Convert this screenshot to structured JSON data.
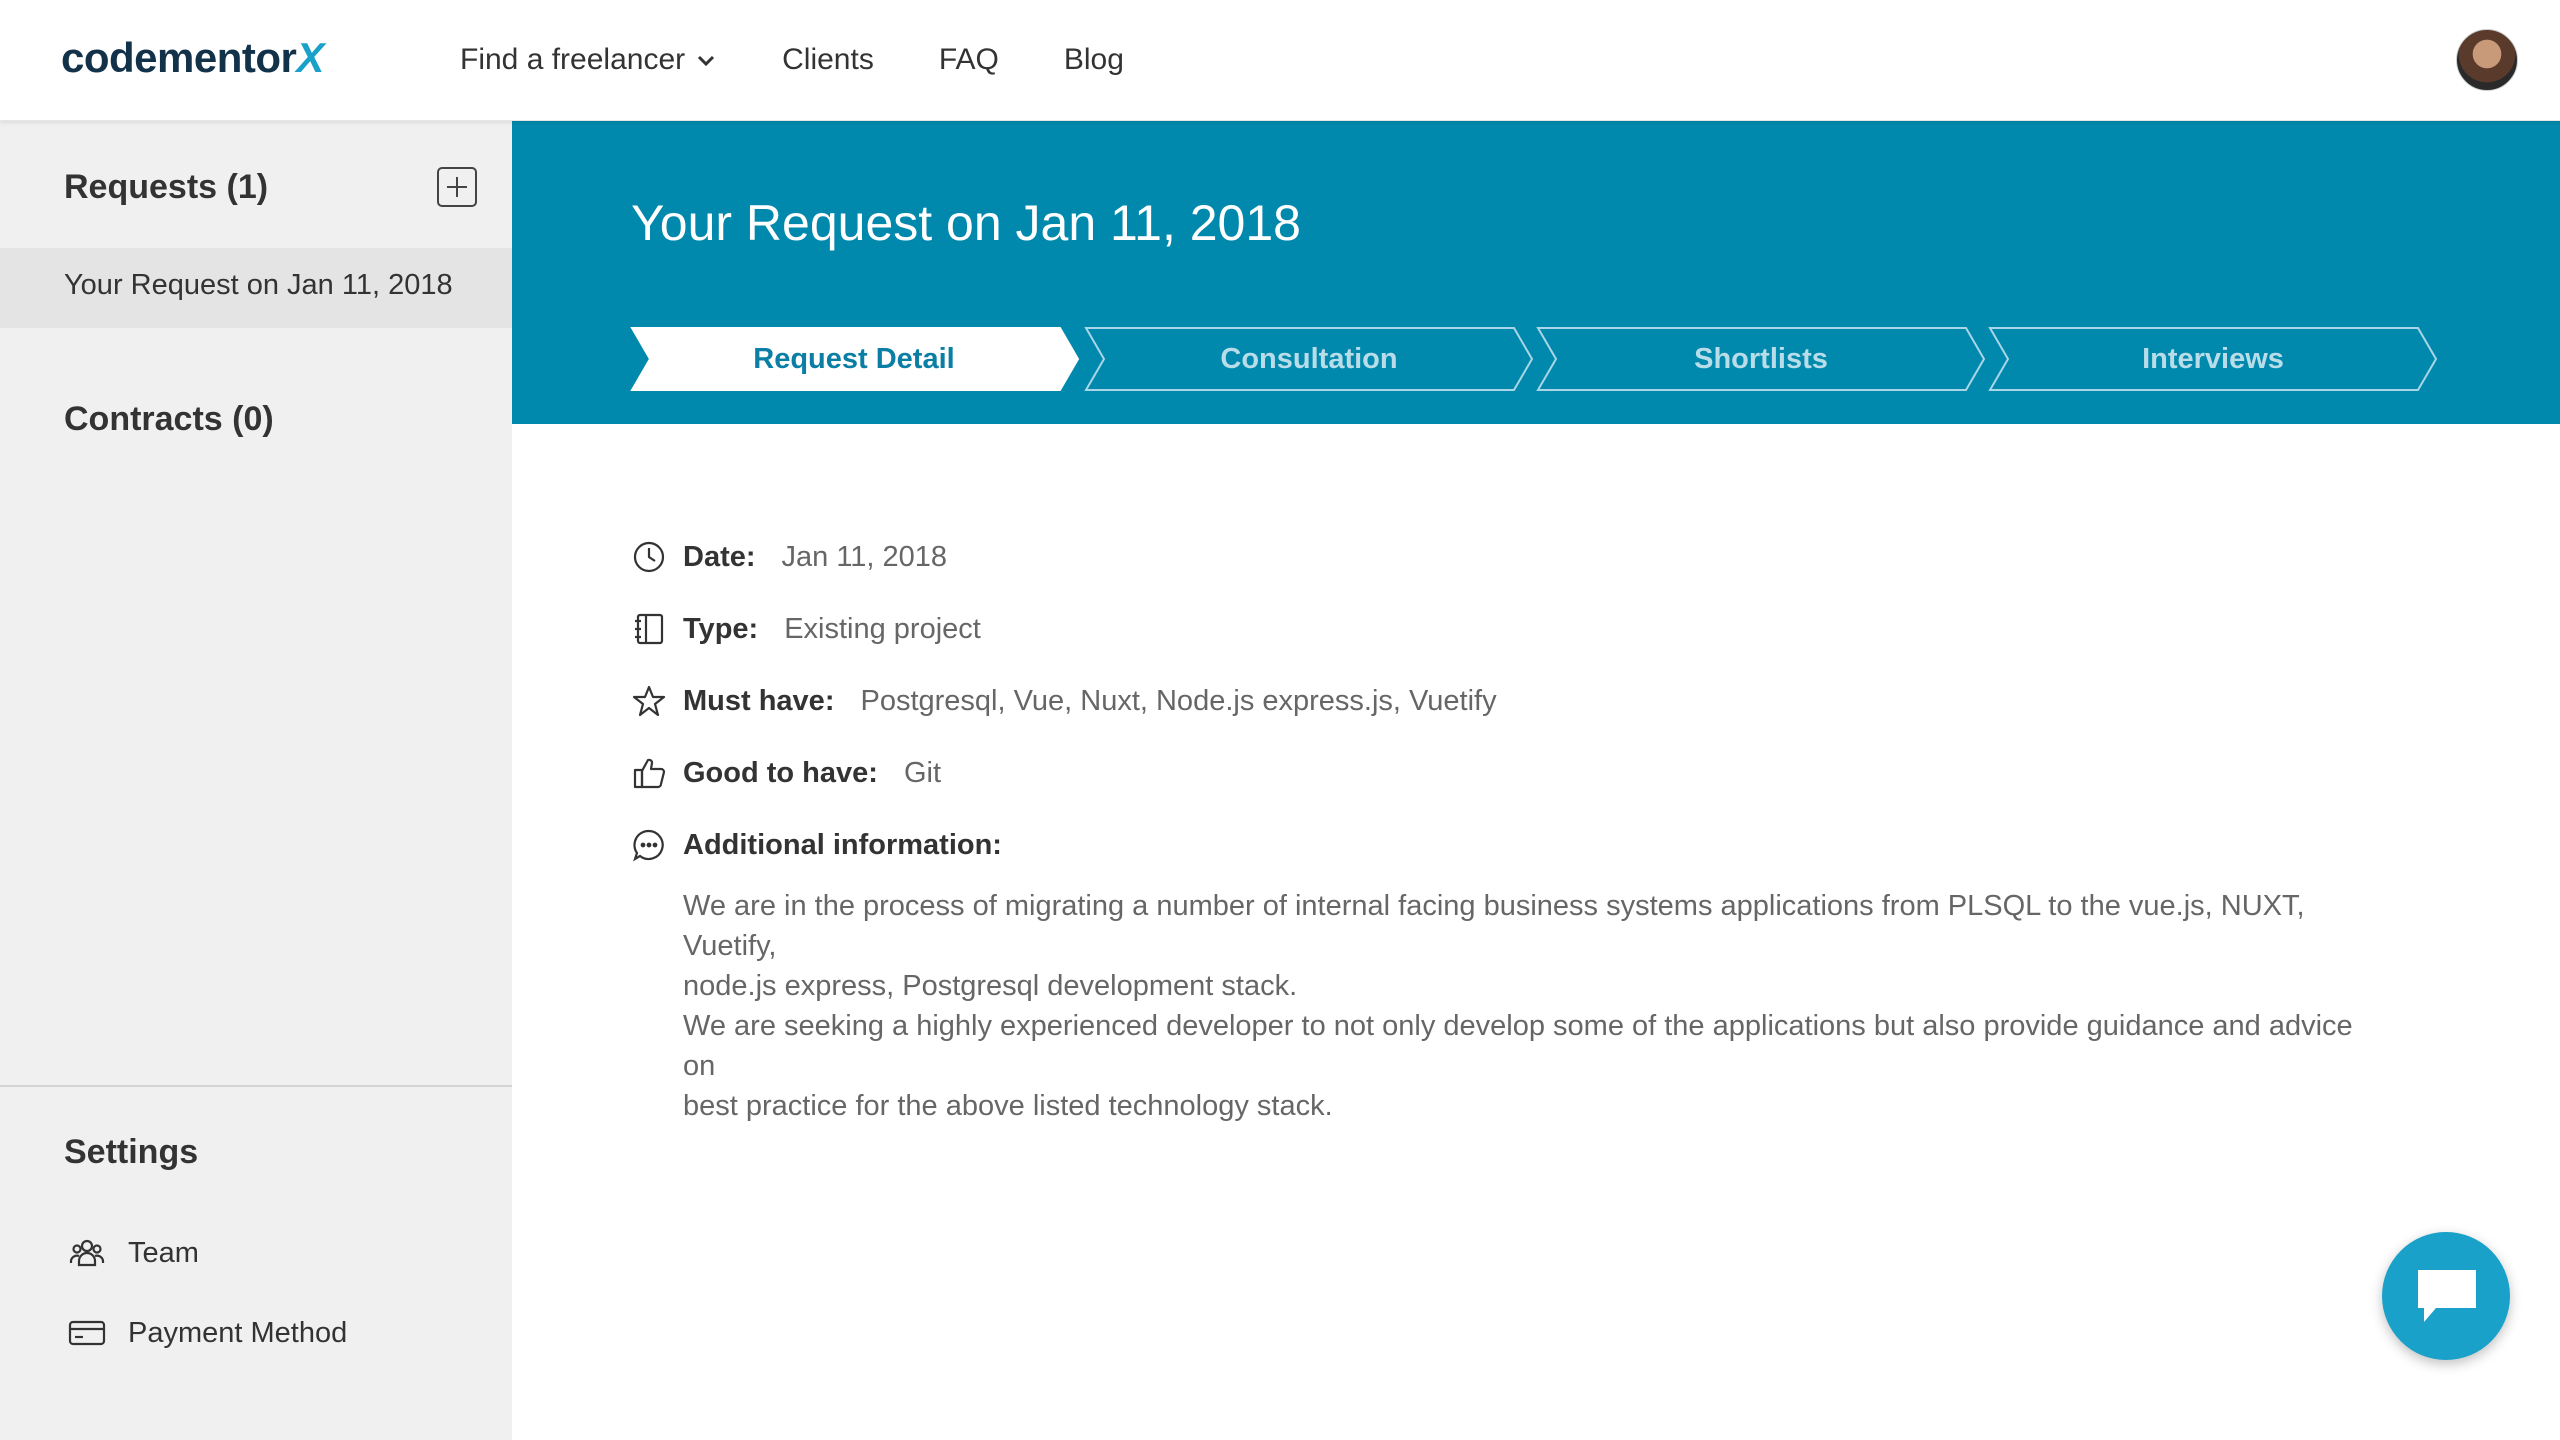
{
  "header": {
    "logo_main": "codementor",
    "logo_suffix": "X",
    "nav": [
      {
        "label": "Find a freelancer",
        "has_dropdown": true
      },
      {
        "label": "Clients"
      },
      {
        "label": "FAQ"
      },
      {
        "label": "Blog"
      }
    ]
  },
  "sidebar": {
    "requests_heading": "Requests (1)",
    "requests": [
      {
        "label": "Your Request on Jan 11, 2018",
        "active": true
      }
    ],
    "contracts_heading": "Contracts (0)",
    "settings_heading": "Settings",
    "settings_items": [
      {
        "label": "Team",
        "icon": "team-icon"
      },
      {
        "label": "Payment Method",
        "icon": "credit-card-icon"
      }
    ]
  },
  "banner": {
    "title": "Your Request on Jan 11, 2018",
    "steps": [
      {
        "label": "Request Detail",
        "active": true
      },
      {
        "label": "Consultation",
        "active": false
      },
      {
        "label": "Shortlists",
        "active": false
      },
      {
        "label": "Interviews",
        "active": false
      }
    ]
  },
  "detail": {
    "date": {
      "label": "Date:",
      "value": "Jan 11, 2018",
      "icon": "clock-icon"
    },
    "type": {
      "label": "Type:",
      "value": "Existing project",
      "icon": "notebook-icon"
    },
    "must_have": {
      "label": "Must have:",
      "value": "Postgresql, Vue, Nuxt, Node.js express.js, Vuetify",
      "icon": "star-icon"
    },
    "good_to_have": {
      "label": "Good to have:",
      "value": "Git",
      "icon": "thumbs-up-icon"
    },
    "additional": {
      "label": "Additional information:",
      "icon": "speech-bubble-icon",
      "paragraph1_line1": "We are in the process of migrating a number of internal facing business systems applications from PLSQL to the vue.js, NUXT, Vuetify,",
      "paragraph1_line2": "node.js express, Postgresql development stack.",
      "paragraph2_line1": "We are seeking a highly experienced developer to not only develop some of the applications but also provide guidance and advice on",
      "paragraph2_line2": "best practice for the above listed technology stack."
    }
  },
  "colors": {
    "brand_dark": "#12324a",
    "accent": "#1aa1c9",
    "banner_bg": "#0089ad",
    "sidebar_bg": "#f0f0f0"
  }
}
